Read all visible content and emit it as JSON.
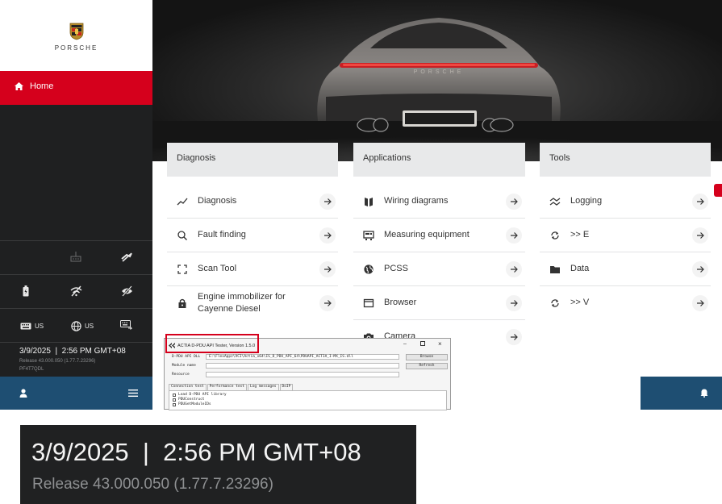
{
  "brand": {
    "name": "PORSCHE"
  },
  "sidebar": {
    "home_label": "Home",
    "status_row_2": [
      {
        "icon": "battery-icon"
      },
      {
        "icon": "wifi-off-icon"
      },
      {
        "icon": "eye-off-icon"
      }
    ],
    "status_row_1": [
      {
        "icon": "vci-device-icon"
      },
      {
        "icon": "link-off-icon"
      }
    ],
    "locale": {
      "keyboard_label": "US",
      "language_label": "US"
    },
    "datetime": "3/9/2025  |  2:56 PM GMT+08",
    "release": "Release 43.000.050 (1.77.7.23296)",
    "serial": "PF4T7QDL"
  },
  "columns": [
    {
      "title": "Diagnosis",
      "items": [
        {
          "label": "Diagnosis",
          "icon": "trend-icon"
        },
        {
          "label": "Fault finding",
          "icon": "search-icon"
        },
        {
          "label": "Scan Tool",
          "icon": "scan-frame-icon"
        },
        {
          "label": "Engine immobilizer for",
          "label2": "Cayenne Diesel",
          "icon": "lock-icon"
        }
      ]
    },
    {
      "title": "Applications",
      "items": [
        {
          "label": "Wiring diagrams",
          "icon": "book-icon"
        },
        {
          "label": "Measuring equipment",
          "icon": "meter-icon"
        },
        {
          "label": "PCSS",
          "icon": "globe-icon"
        },
        {
          "label": "Browser",
          "icon": "window-icon"
        },
        {
          "label": "Camera",
          "icon": "camera-icon"
        }
      ]
    },
    {
      "title": "Tools",
      "items": [
        {
          "label": "Logging",
          "icon": "logging-icon"
        },
        {
          "label": ">> E",
          "icon": "sync-icon"
        },
        {
          "label": "Data",
          "icon": "folder-icon"
        },
        {
          "label": ">> V",
          "icon": "sync-icon"
        }
      ]
    }
  ],
  "dialog": {
    "title": "ACTIA D-PDU API Tester, Version 1.5.0",
    "dll_label": "D-PDU API DLL",
    "dll_value": "E:\\FlexAppz\\VCI\\Actia_x64\\IS_D_PDU_API_64\\PDUAPI_ACTIA_I-MX_IS.dll",
    "module_label": "Module name",
    "resource_label": "Resource",
    "browse_label": "Browse",
    "refresh_label": "Refresh",
    "tabs": [
      "Connection test",
      "Performance test",
      "Log messages",
      "DoIP"
    ],
    "list": [
      "Load D-PDU API library",
      "PDUConstruct",
      "PDUGetModuleIDs"
    ]
  },
  "zoom": {
    "datetime": "3/9/2025  |  2:56 PM GMT+08",
    "release": "Release 43.000.050 (1.77.7.23296)"
  },
  "colors": {
    "accent_red": "#d5001c",
    "sidebar_dark": "#1f2021",
    "bottom_blue": "#1e4e72"
  }
}
